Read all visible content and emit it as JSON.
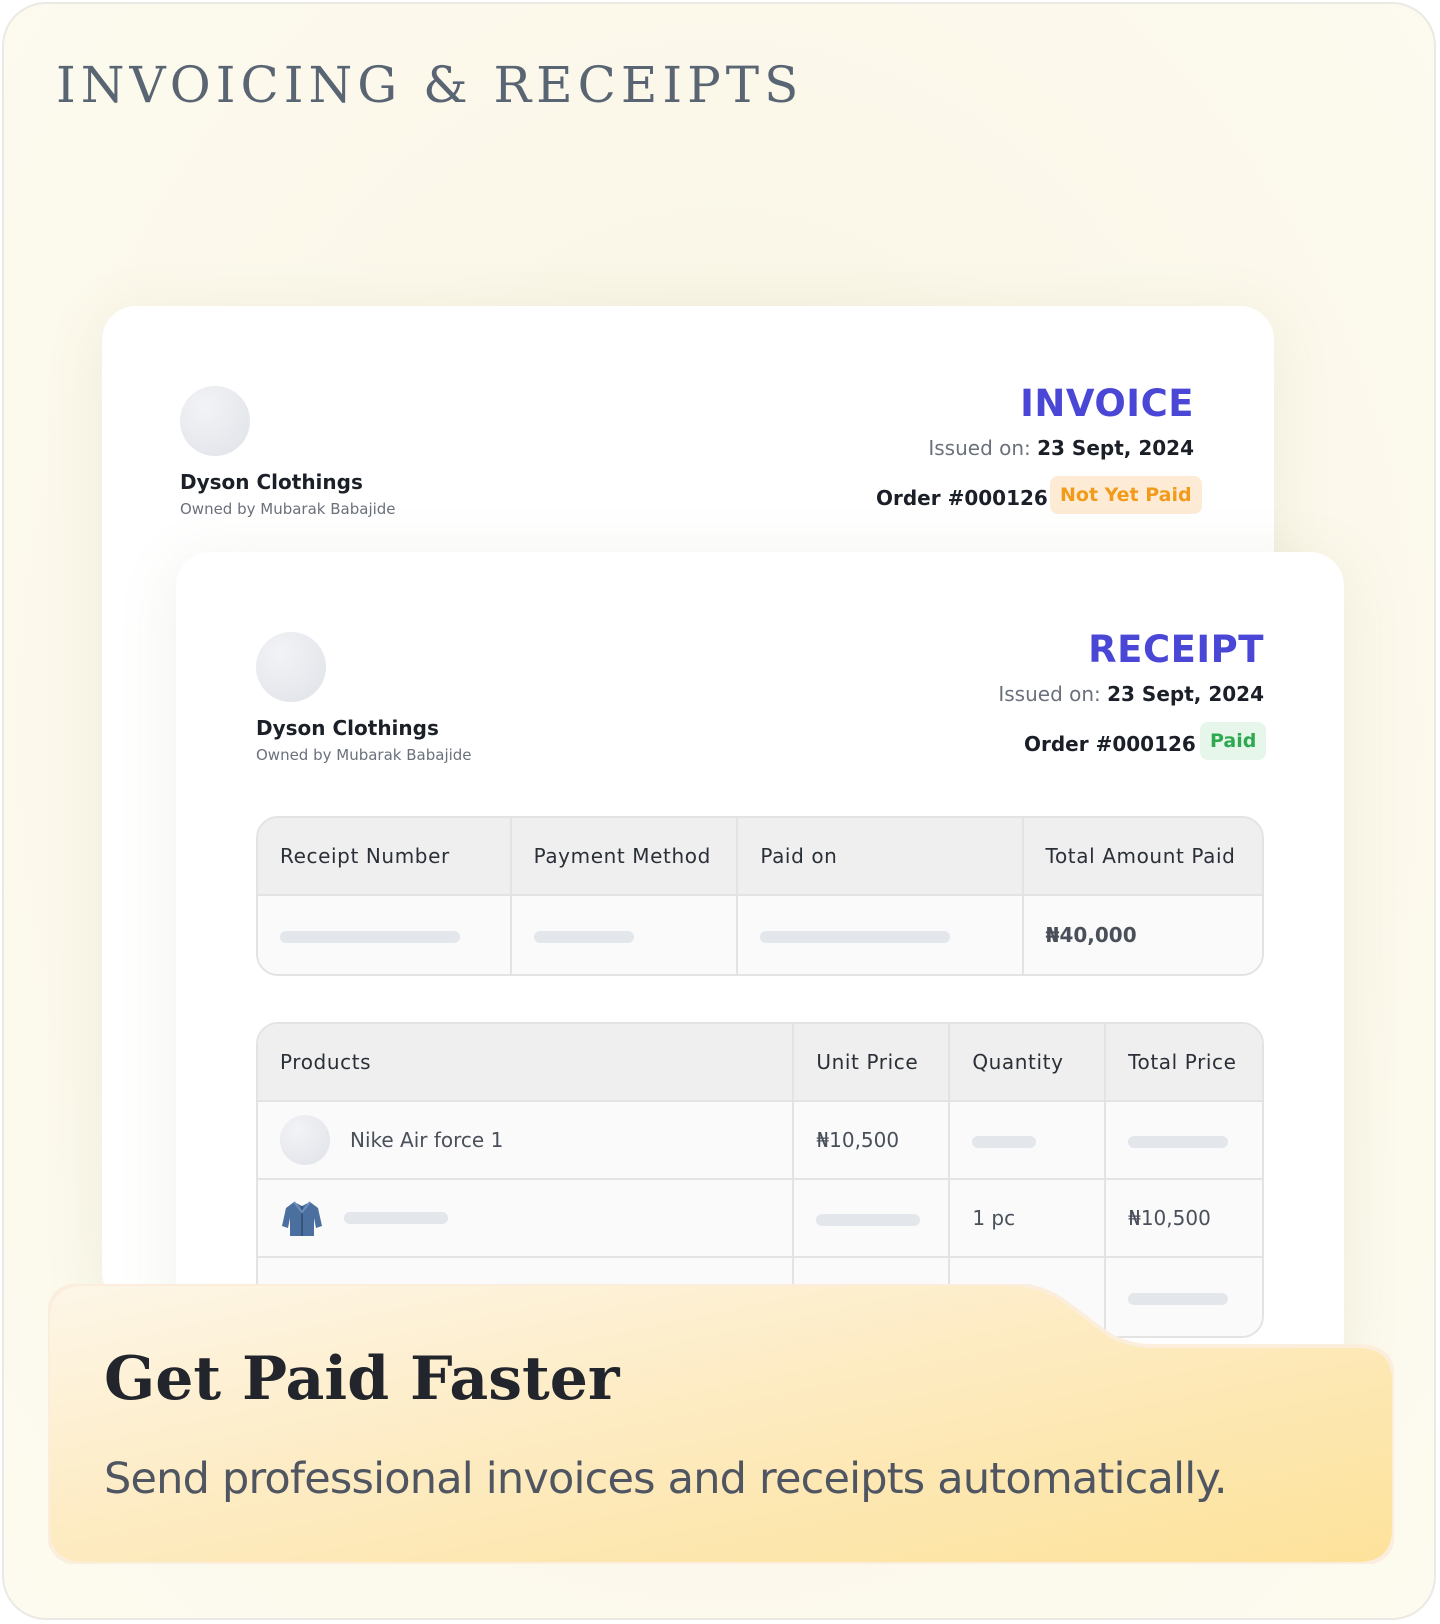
{
  "section_title": "INVOICING & RECEIPTS",
  "invoice": {
    "title": "INVOICE",
    "issued_label": "Issued on:",
    "issued_date": "23 Sept, 2024",
    "business_name": "Dyson Clothings",
    "owner": "Owned by Mubarak Babajide",
    "order": "Order #000126",
    "status": "Not Yet Paid",
    "status_color": "#f29a1a"
  },
  "receipt": {
    "title": "RECEIPT",
    "issued_label": "Issued on:",
    "issued_date": "23 Sept, 2024",
    "business_name": "Dyson Clothings",
    "owner": "Owned by Mubarak Babajide",
    "order": "Order #000126",
    "status": "Paid",
    "status_color": "#2da94f",
    "summary_table": {
      "headers": [
        "Receipt Number",
        "Payment Method",
        "Paid on",
        "Total Amount Paid"
      ],
      "total_amount_paid": "₦40,000"
    },
    "products_table": {
      "headers": [
        "Products",
        "Unit Price",
        "Quantity",
        "Total Price"
      ],
      "rows": [
        {
          "product": "Nike Air force 1",
          "unit_price": "₦10,500",
          "quantity": "",
          "total_price": ""
        },
        {
          "product": "",
          "unit_price": "",
          "quantity": "1 pc",
          "total_price": "₦10,500"
        }
      ]
    }
  },
  "banner": {
    "title": "Get Paid Faster",
    "text": "Send professional invoices and receipts automatically."
  },
  "colors": {
    "accent": "#4b47d6",
    "heading_gray": "#5a6573"
  }
}
